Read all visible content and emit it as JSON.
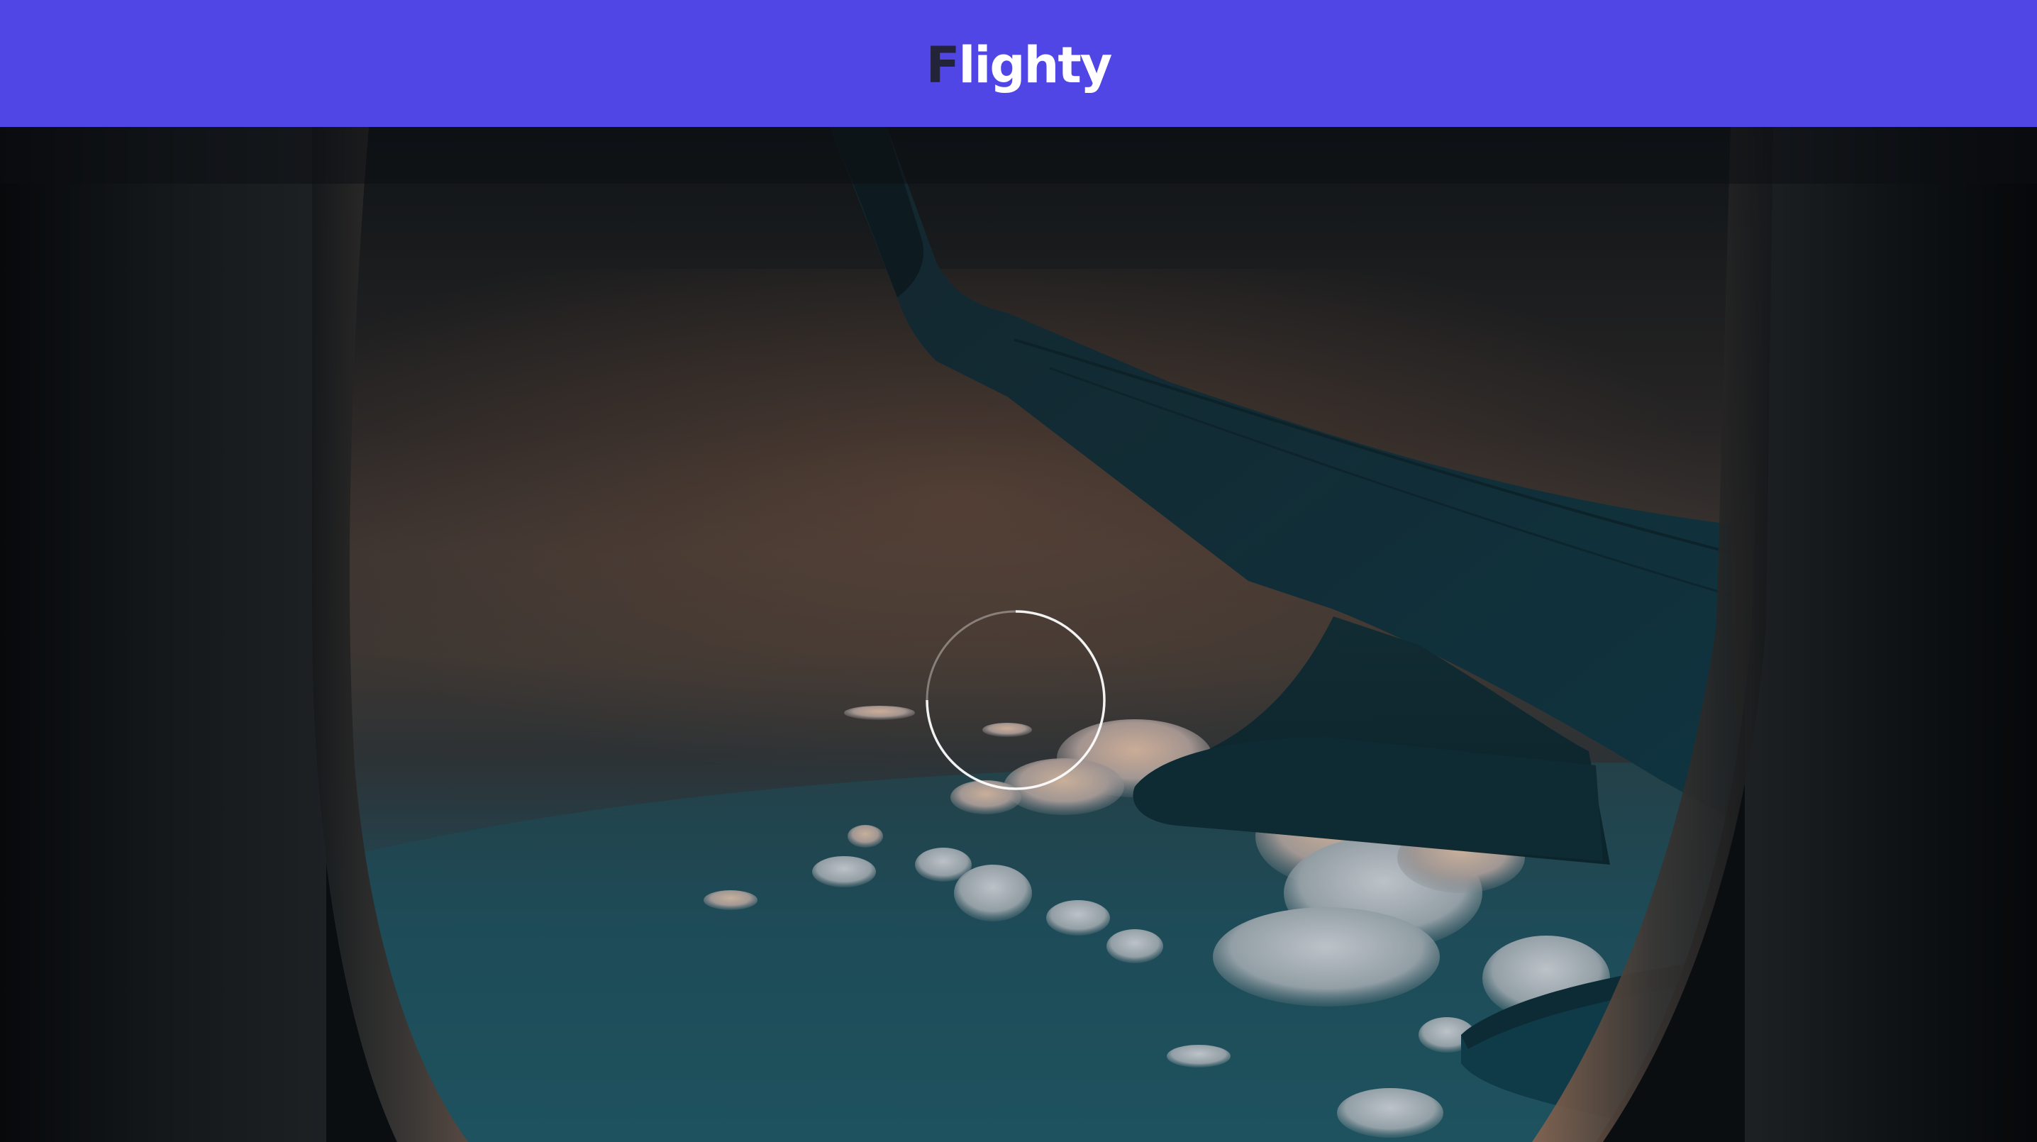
{
  "header": {
    "logo_first_letter": "F",
    "logo_rest": "lighty",
    "background_color": "#5046e5"
  },
  "hero": {
    "image": "airplane-window-view",
    "loading_indicator": "loading-spinner-icon"
  },
  "colors": {
    "brand": "#5046e5",
    "logo_dark": "#23233a",
    "spinner": "#ffffff"
  }
}
